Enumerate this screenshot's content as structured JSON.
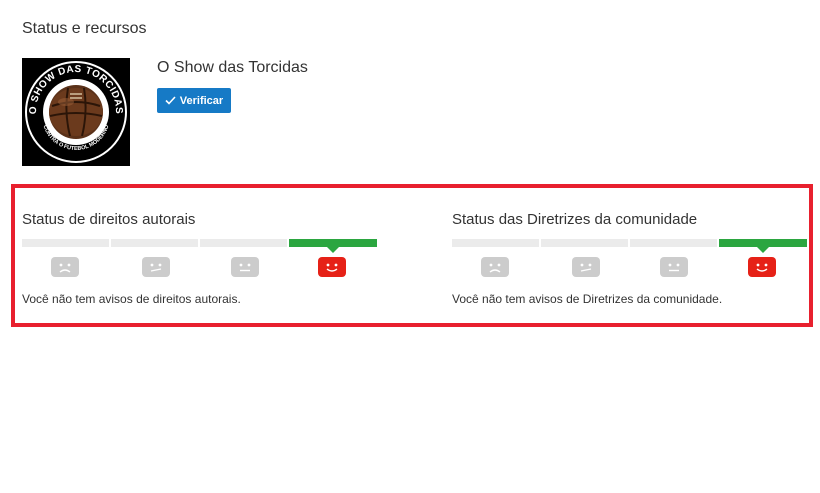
{
  "page": {
    "title": "Status e recursos"
  },
  "channel": {
    "name": "O Show das Torcidas",
    "logo_text_top": "O SHOW DAS TORCIDAS",
    "logo_text_bottom": "CONTRA O FUTEBOL MODERNO",
    "verify_label": "Verificar"
  },
  "copyright": {
    "title": "Status de direitos autorais",
    "message": "Você não tem avisos de direitos autorais.",
    "active_level": 4,
    "icons": [
      "sad-face-icon",
      "skeptical-face-icon",
      "neutral-face-icon",
      "happy-face-icon"
    ]
  },
  "community": {
    "title": "Status das Diretrizes da comunidade",
    "message": "Você não tem avisos de Diretrizes da comunidade.",
    "active_level": 4,
    "icons": [
      "sad-face-icon",
      "skeptical-face-icon",
      "neutral-face-icon",
      "happy-face-icon"
    ]
  },
  "colors": {
    "accent_blue": "#167ac6",
    "status_green": "#2ba640",
    "status_red": "#e62117",
    "inactive_gray": "#cccccc",
    "highlight_border": "#e8202e"
  }
}
